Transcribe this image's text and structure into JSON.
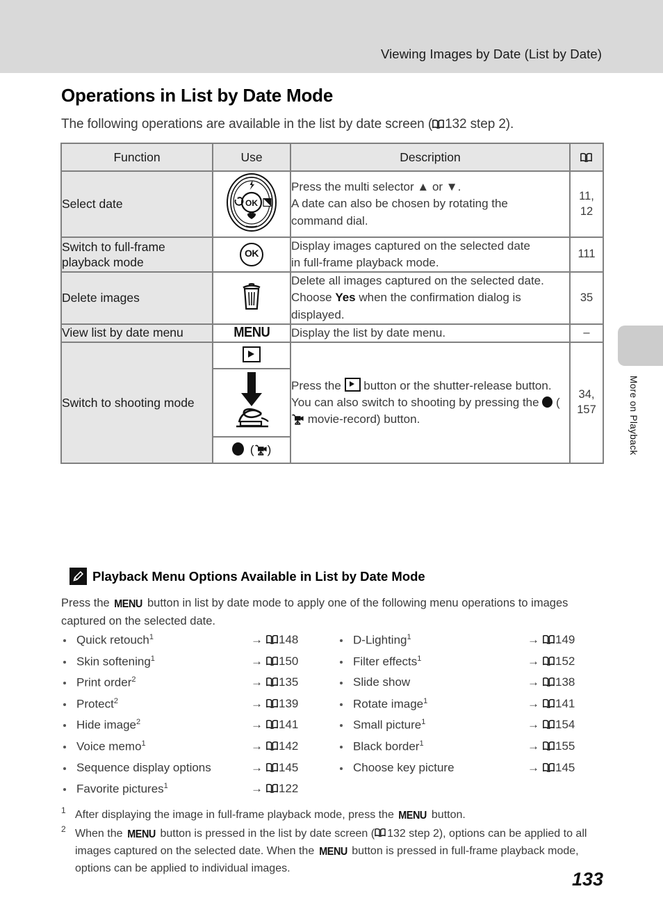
{
  "header": {
    "running_title": "Viewing Images by Date (List by Date)",
    "side_tab_label": "More on Playback"
  },
  "section": {
    "title": "Operations in List by Date Mode",
    "intro_before": "The following operations are available in the list by date screen (",
    "intro_ref": "132 step 2).",
    "intro_icon": "book-icon"
  },
  "table": {
    "columns": [
      "Function",
      "Use",
      "Description",
      "book-icon"
    ],
    "rows": [
      {
        "function": "Select date",
        "use_icon": "multi-selector-dial-icon",
        "description_lines": [
          "Press the multi selector ▲ or ▼.",
          "A date can also be chosen by rotating the",
          "command dial."
        ],
        "page": "11,\n12"
      },
      {
        "function": "Switch to full-frame playback mode",
        "use_icon": "ok-button-icon",
        "description_lines": [
          "Display images captured on the selected date",
          "in full-frame playback mode."
        ],
        "page": "111"
      },
      {
        "function": "Delete images",
        "use_icon": "trash-can-icon",
        "description_pre": "Delete all images captured on the selected date. Choose ",
        "description_bold": "Yes",
        "description_post": " when the confirmation dialog is displayed.",
        "page": "35"
      },
      {
        "function": "View list by date menu",
        "use_icon": "menu-button-icon",
        "use_label": "MENU",
        "description_lines": [
          "Display the list by date menu."
        ],
        "page": "–"
      },
      {
        "function": "Switch to shooting mode",
        "use_icons": [
          "playback-button-icon",
          "shutter-release-press-icon",
          "movie-record-button-icon"
        ],
        "description_pre": "Press the ",
        "description_mid": " button or the shutter-release button. You can also switch to shooting by pressing the ",
        "description_post": " movie-record) button.",
        "page": "34,\n157"
      }
    ]
  },
  "note": {
    "icon": "pencil-note-icon",
    "title": "Playback Menu Options Available in List by Date Mode",
    "body_pre": "Press the ",
    "body_menu": "MENU",
    "body_post": " button in list by date mode to apply one of the following menu operations to images captured on the selected date."
  },
  "menu_options": {
    "left": [
      {
        "label": "Quick retouch",
        "sup": "1",
        "ref": "148"
      },
      {
        "label": "Skin softening",
        "sup": "1",
        "ref": "150"
      },
      {
        "label": "Print order",
        "sup": "2",
        "ref": "135"
      },
      {
        "label": "Protect",
        "sup": "2",
        "ref": "139"
      },
      {
        "label": "Hide image",
        "sup": "2",
        "ref": "141"
      },
      {
        "label": "Voice memo",
        "sup": "1",
        "ref": "142"
      },
      {
        "label": "Sequence display options",
        "sup": "",
        "ref": "145"
      },
      {
        "label": "Favorite pictures",
        "sup": "1",
        "ref": "122"
      }
    ],
    "right": [
      {
        "label": "D-Lighting",
        "sup": "1",
        "ref": "149"
      },
      {
        "label": "Filter effects",
        "sup": "1",
        "ref": "152"
      },
      {
        "label": "Slide show",
        "sup": "",
        "ref": "138"
      },
      {
        "label": "Rotate image",
        "sup": "1",
        "ref": "141"
      },
      {
        "label": "Small picture",
        "sup": "1",
        "ref": "154"
      },
      {
        "label": "Black border",
        "sup": "1",
        "ref": "155"
      },
      {
        "label": "Choose key picture",
        "sup": "",
        "ref": "145"
      }
    ]
  },
  "footnotes": [
    {
      "mark": "1",
      "pre": "After displaying the image in full-frame playback mode, press the ",
      "menu": "MENU",
      "post": " button."
    },
    {
      "mark": "2",
      "pre": "When the ",
      "menu": "MENU",
      "mid1": " button is pressed in the list by date screen (",
      "ref": "132 step 2), options can be applied to all images captured on the selected date. When the ",
      "menu2": "MENU",
      "post": " button is pressed in full-frame playback mode, options can be applied to individual images."
    }
  ],
  "folio": "133"
}
